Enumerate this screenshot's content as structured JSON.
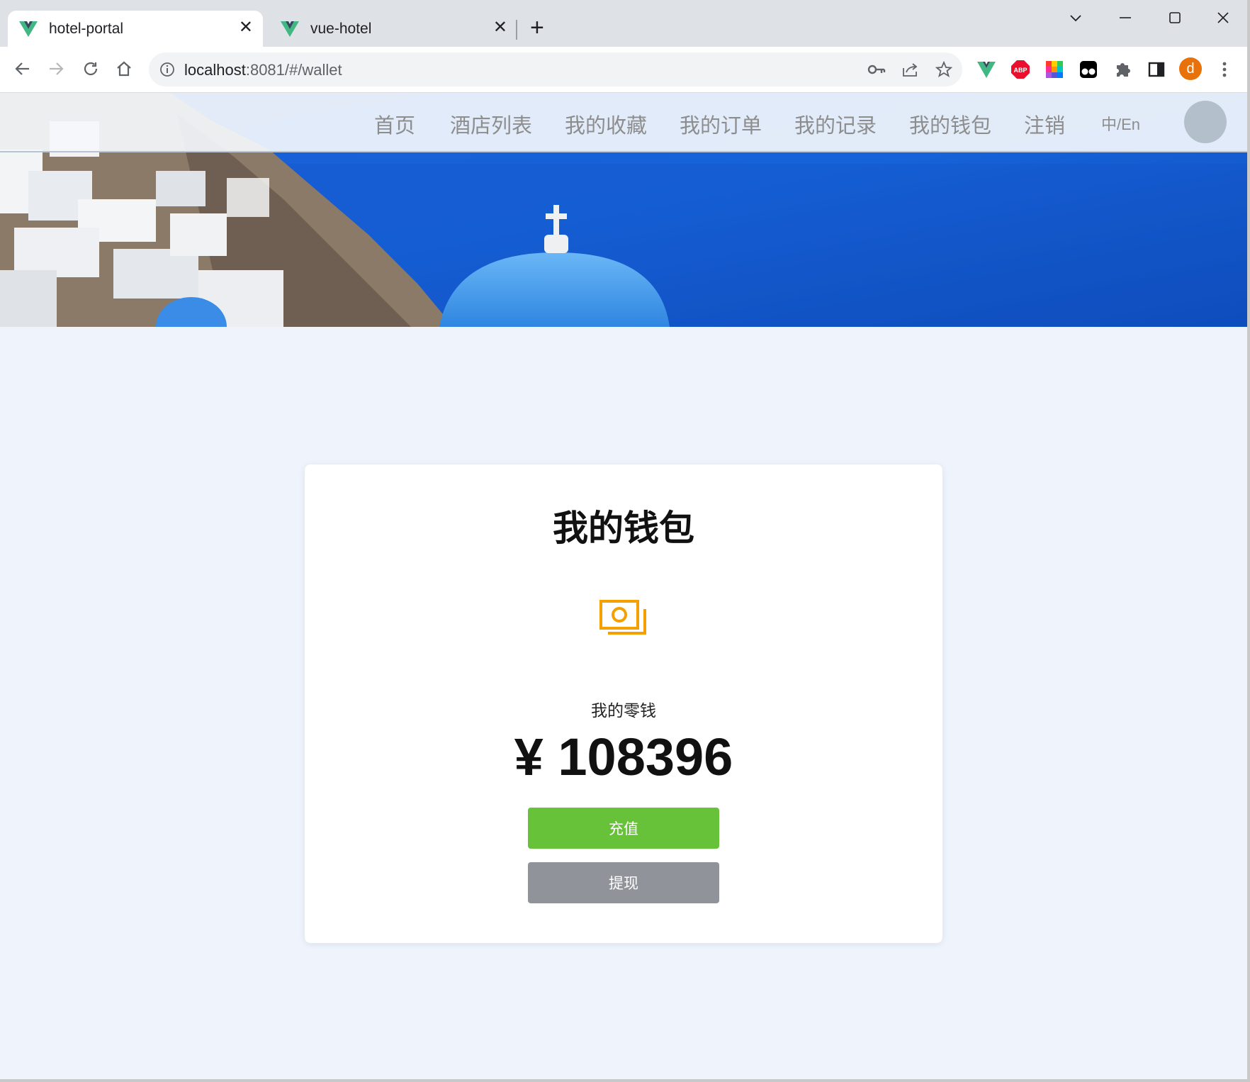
{
  "browser": {
    "tabs": [
      {
        "title": "hotel-portal",
        "close": "✕"
      },
      {
        "title": "vue-hotel",
        "close": "✕"
      }
    ],
    "new_tab": "+",
    "window_controls": {
      "dropdown": "⌵",
      "minimize": "—",
      "maximize": "☐",
      "close": "✕"
    },
    "url_host": "localhost",
    "url_path": ":8081/#/wallet",
    "profile_initial": "d",
    "extensions": [
      "vue-devtools-icon",
      "adblock-plus-icon",
      "color-palette-icon",
      "tampermonkey-icon",
      "puzzle-icon",
      "side-panel-icon"
    ],
    "colors": {
      "profile": "#e8710a",
      "abp": "#e8102c",
      "vue_green": "#41b883",
      "vue_dark": "#34495e"
    }
  },
  "site_nav": {
    "items": [
      "首页",
      "酒店列表",
      "我的收藏",
      "我的订单",
      "我的记录",
      "我的钱包",
      "注销"
    ],
    "lang_toggle": "中/En"
  },
  "wallet": {
    "title": "我的钱包",
    "balance_label": "我的零钱",
    "balance_amount": "¥ 108396",
    "recharge_button": "充值",
    "withdraw_button": "提现",
    "icon": "money-icon",
    "colors": {
      "icon": "#f5a000",
      "recharge": "#67c23a",
      "withdraw": "#909399",
      "page_bg": "#eef3fc"
    }
  }
}
